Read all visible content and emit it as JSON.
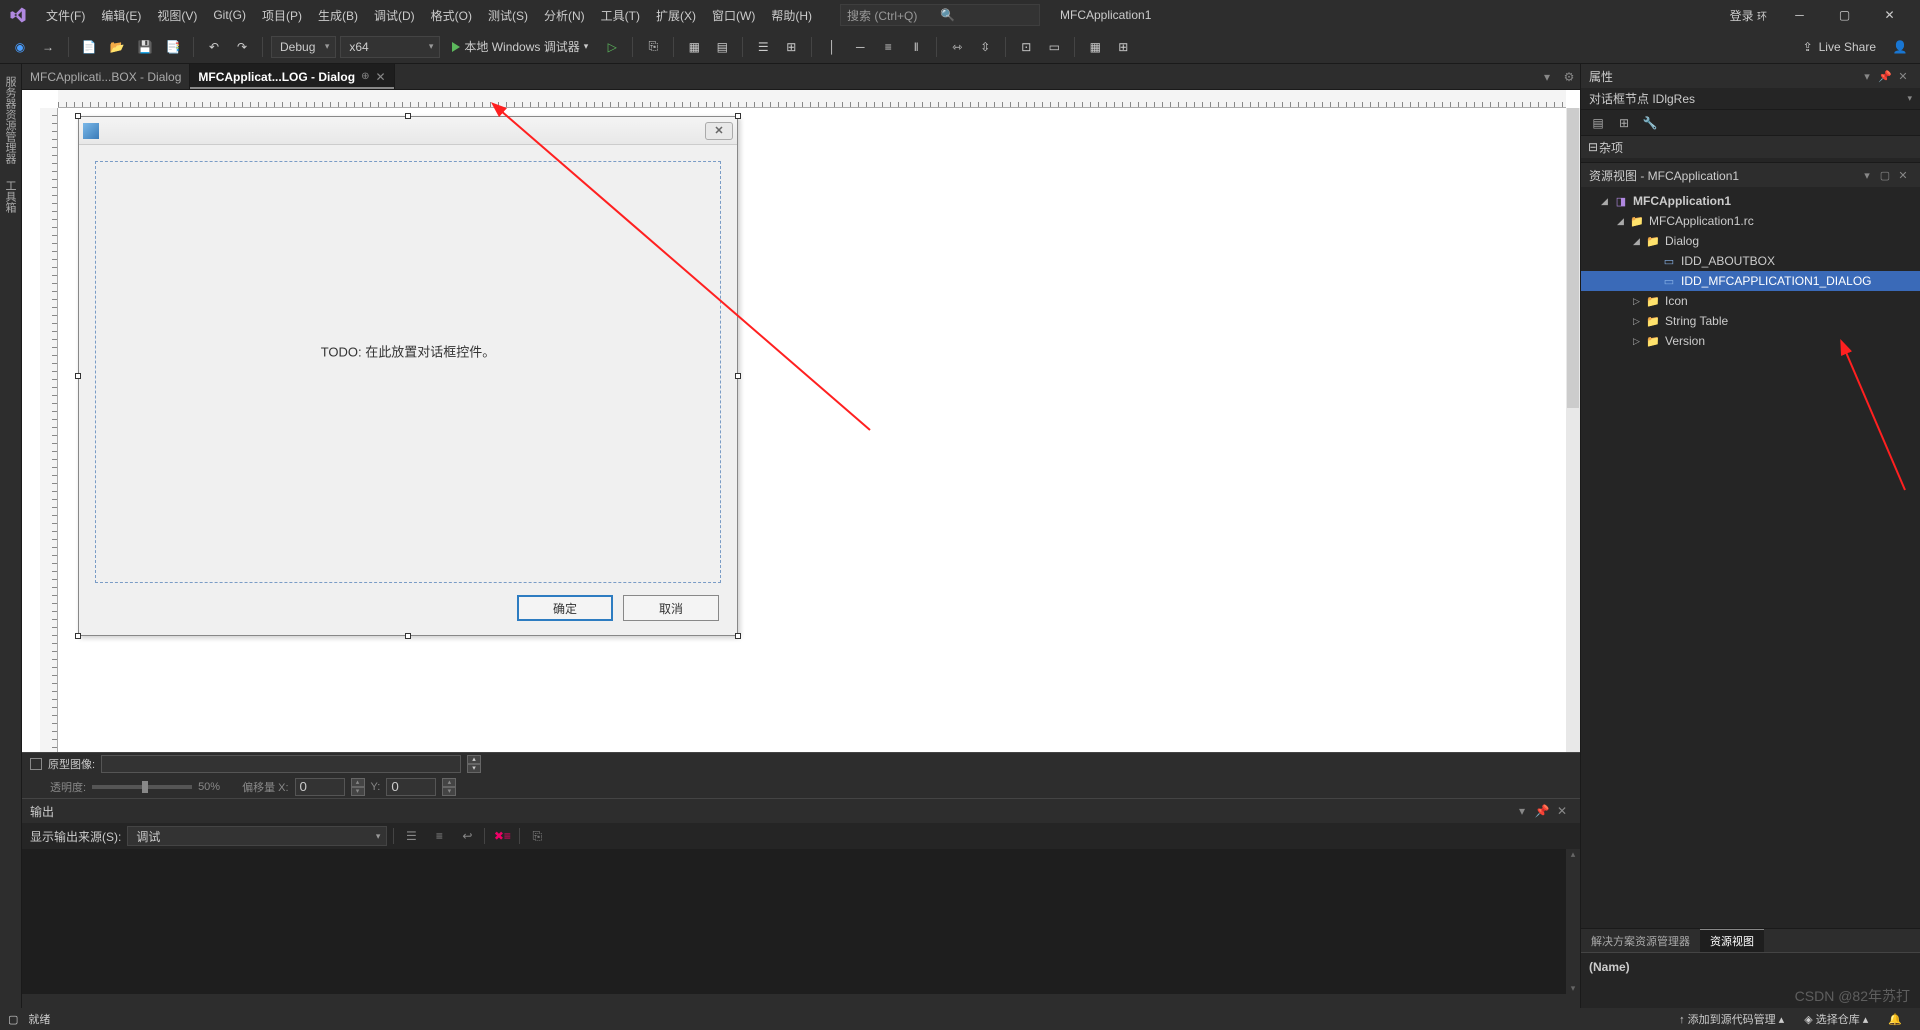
{
  "menubar": {
    "items": [
      "文件(F)",
      "编辑(E)",
      "视图(V)",
      "Git(G)",
      "项目(P)",
      "生成(B)",
      "调试(D)",
      "格式(O)",
      "测试(S)",
      "分析(N)",
      "工具(T)",
      "扩展(X)",
      "窗口(W)",
      "帮助(H)"
    ],
    "search_placeholder": "搜索 (Ctrl+Q)",
    "app_title": "MFCApplication1",
    "login": "登录",
    "login_badge": "环"
  },
  "toolbar": {
    "config": "Debug",
    "platform": "x64",
    "debug_label": "本地 Windows 调试器",
    "live_share": "Live Share"
  },
  "left_tabs": [
    "服务器资源管理器",
    "工具箱"
  ],
  "doc_tabs": [
    {
      "label": "MFCApplicati...BOX - Dialog",
      "active": false
    },
    {
      "label": "MFCApplicat...LOG - Dialog",
      "active": true
    }
  ],
  "dialog": {
    "todo": "TODO: 在此放置对话框控件。",
    "ok": "确定",
    "cancel": "取消"
  },
  "designer_footer": {
    "prototype_image": "原型图像:",
    "transparency": "透明度:",
    "transparency_value": "50%",
    "offset_x_label": "偏移量 X:",
    "offset_x": "0",
    "offset_y_label": "Y:",
    "offset_y": "0"
  },
  "output": {
    "title": "输出",
    "source_label": "显示输出来源(S):",
    "source_value": "调试"
  },
  "properties": {
    "title": "属性",
    "subtitle": "对话框节点 IDlgRes",
    "category": "杂项",
    "name_label": "(Name)"
  },
  "resource_view": {
    "title": "资源视图 - MFCApplication1",
    "tree": {
      "root": "MFCApplication1",
      "rc": "MFCApplication1.rc",
      "dialog_folder": "Dialog",
      "aboutbox": "IDD_ABOUTBOX",
      "main_dialog": "IDD_MFCAPPLICATION1_DIALOG",
      "icon": "Icon",
      "string_table": "String Table",
      "version": "Version"
    }
  },
  "panel_tabs": {
    "solution": "解决方案资源管理器",
    "resource": "资源视图"
  },
  "statusbar": {
    "ready": "就绪",
    "add_src": "添加到源代码管理",
    "select_repo": "选择仓库"
  },
  "watermark": "CSDN @82年苏打"
}
